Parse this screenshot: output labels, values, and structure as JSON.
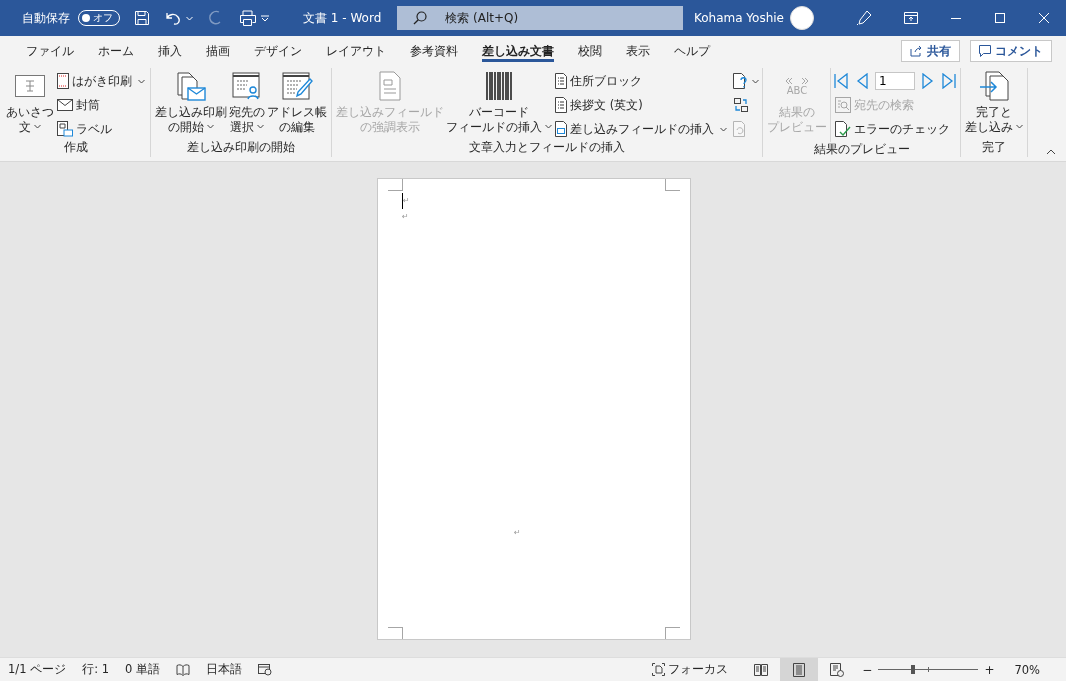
{
  "title_bar": {
    "autosave_label": "自動保存",
    "autosave": {
      "label": "オフ",
      "on": false
    },
    "document_title": "文書 1  -  Word",
    "search": {
      "placeholder": "検索 (Alt+Q)"
    },
    "user_name": "Kohama Yoshie",
    "redo_disabled": true
  },
  "tabs": [
    {
      "label": "ファイル",
      "selected": false
    },
    {
      "label": "ホーム",
      "selected": false
    },
    {
      "label": "挿入",
      "selected": false
    },
    {
      "label": "描画",
      "selected": false
    },
    {
      "label": "デザイン",
      "selected": false
    },
    {
      "label": "レイアウト",
      "selected": false
    },
    {
      "label": "参考資料",
      "selected": false
    },
    {
      "label": "差し込み文書",
      "selected": true
    },
    {
      "label": "校閲",
      "selected": false
    },
    {
      "label": "表示",
      "selected": false
    },
    {
      "label": "ヘルプ",
      "selected": false
    }
  ],
  "share_button": "共有",
  "comment_button": "コメント",
  "ribbon": {
    "groups": [
      {
        "label": "作成",
        "large": [
          {
            "label": [
              "あいさつ",
              "文"
            ],
            "dropdown": true,
            "disabled": false
          }
        ],
        "small": [
          {
            "label": "はがき印刷",
            "dropdown": true,
            "disabled": false
          },
          {
            "label": "封筒",
            "dropdown": false,
            "disabled": false
          },
          {
            "label": "ラベル",
            "dropdown": false,
            "disabled": false
          }
        ]
      },
      {
        "label": "差し込み印刷の開始",
        "large": [
          {
            "label": [
              "差し込み印刷",
              "の開始"
            ],
            "dropdown": true,
            "disabled": false
          },
          {
            "label": [
              "宛先の",
              "選択"
            ],
            "dropdown": true,
            "disabled": false
          },
          {
            "label": [
              "アドレス帳",
              "の編集"
            ],
            "dropdown": false,
            "disabled": false
          }
        ]
      },
      {
        "label": "文章入力とフィールドの挿入",
        "large": [
          {
            "label": [
              "差し込みフィールド",
              "の強調表示"
            ],
            "dropdown": false,
            "disabled": true
          },
          {
            "label": [
              "バーコード",
              "フィールドの挿入"
            ],
            "dropdown": true,
            "disabled": false
          }
        ],
        "small": [
          {
            "label": "住所ブロック",
            "dropdown": false,
            "disabled": false
          },
          {
            "label": "挨拶文 (英文)",
            "dropdown": false,
            "disabled": false
          },
          {
            "label": "差し込みフィールドの挿入",
            "dropdown": true,
            "disabled": false
          }
        ],
        "icons": [
          {
            "dropdown": true,
            "disabled": false
          },
          {
            "dropdown": false,
            "disabled": false
          },
          {
            "dropdown": false,
            "disabled": true
          }
        ]
      },
      {
        "label": "結果のプレビュー",
        "large": [
          {
            "label": [
              "結果の",
              "プレビュー"
            ],
            "dropdown": false,
            "disabled": true,
            "icon_text": "ABC"
          }
        ],
        "record": "1",
        "small": [
          {
            "label": "宛先の検索",
            "dropdown": false,
            "disabled": true
          },
          {
            "label": "エラーのチェック",
            "dropdown": false,
            "disabled": false
          }
        ]
      },
      {
        "label": "完了",
        "large": [
          {
            "label": [
              "完了と",
              "差し込み"
            ],
            "dropdown": true,
            "disabled": false
          }
        ]
      }
    ]
  },
  "page": {
    "paragraph_marks": [
      "↵",
      "↵",
      "↵"
    ]
  },
  "status_bar": {
    "page": "1/1 ページ",
    "line": "行: 1",
    "words": "0 単語",
    "language": "日本語",
    "focus": "フォーカス",
    "views": [
      {
        "selected": false
      },
      {
        "selected": true
      },
      {
        "selected": false
      }
    ],
    "zoom_minus": "−",
    "zoom_plus": "+",
    "zoom": {
      "level": 0.35
    },
    "zoom_percent": "70%"
  }
}
